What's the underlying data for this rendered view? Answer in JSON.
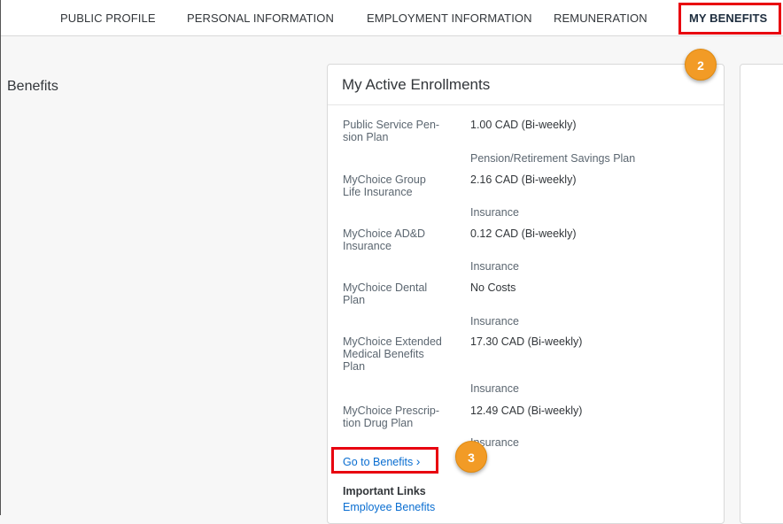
{
  "nav": {
    "tabs": [
      {
        "label": "PUBLIC PROFILE"
      },
      {
        "label": "PERSONAL INFORMATION"
      },
      {
        "label": "EMPLOYMENT INFORMATION"
      },
      {
        "label": "REMUNERATION"
      },
      {
        "label": "MY BENEFITS",
        "active": true
      }
    ]
  },
  "callouts": {
    "step2": "2",
    "step3": "3"
  },
  "section_title": "Benefits",
  "card": {
    "title": "My Active Enrollments",
    "enrollments": [
      {
        "name": "Public Service Pen-\nsion Plan",
        "value": "1.00 CAD (Bi-weekly)",
        "category": "Pension/Retirement Savings Plan"
      },
      {
        "name": "MyChoice Group\nLife Insurance",
        "value": "2.16 CAD (Bi-weekly)",
        "category": "Insurance"
      },
      {
        "name": "MyChoice AD&D\nInsurance",
        "value": "0.12 CAD (Bi-weekly)",
        "category": "Insurance"
      },
      {
        "name": "MyChoice Dental\nPlan",
        "value": "No Costs",
        "category": "Insurance"
      },
      {
        "name": "MyChoice Extended\nMedical Benefits\nPlan",
        "value": "17.30 CAD (Bi-weekly)",
        "category": "Insurance"
      },
      {
        "name": "MyChoice Prescrip-\ntion Drug Plan",
        "value": "12.49 CAD (Bi-weekly)",
        "category": "Insurance"
      }
    ],
    "go_to_benefits": "Go to Benefits",
    "chevron": "›",
    "important_links_heading": "Important Links",
    "employee_benefits_link": "Employee Benefits"
  },
  "colors": {
    "highlight": "#e8000f",
    "badge": "#f29b26",
    "link": "#0a6ed1"
  }
}
